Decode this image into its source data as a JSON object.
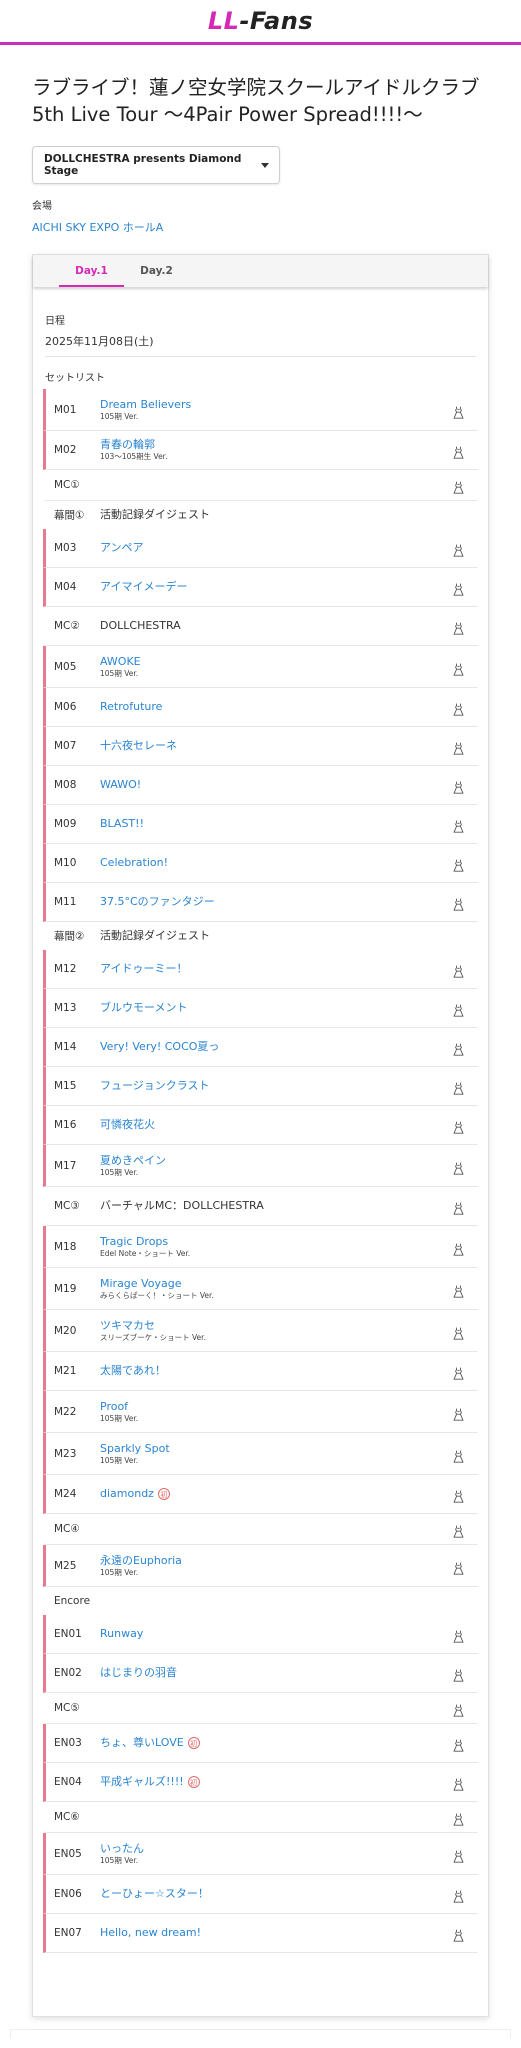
{
  "header": {
    "logo_a": "LL",
    "logo_b": "-Fans",
    "accent_color": "#d62ab6"
  },
  "page": {
    "title_line1": "ラブライブ！蓮ノ空女学院スクールアイドルクラブ",
    "title_line2": "5th Live Tour 〜4Pair Power Spread!!!!〜",
    "stage_select_value": "DOLLCHESTRA presents Diamond Stage",
    "venue_label": "会場",
    "venue_value": "AICHI SKY EXPO ホールA"
  },
  "tabs": [
    {
      "label": "Day.1",
      "active": true
    },
    {
      "label": "Day.2",
      "active": false
    }
  ],
  "day": {
    "date_label": "日程",
    "date_value": "2025年11月08日(土)",
    "setlist_label": "セットリスト"
  },
  "setlist": [
    {
      "num": "M01",
      "title": "Dream Believers",
      "ver": "105期 Ver.",
      "song": true
    },
    {
      "num": "M02",
      "title": "青春の輪郭",
      "ver": "103〜105期生 Ver.",
      "song": true
    },
    {
      "num": "MC①",
      "title": "",
      "ver": "",
      "song": false
    },
    {
      "num": "幕間①",
      "title": "活動記録ダイジェスト",
      "ver": "",
      "song": false,
      "plain": true
    },
    {
      "num": "M03",
      "title": "アンペア",
      "ver": "",
      "song": true
    },
    {
      "num": "M04",
      "title": "アイマイメーデー",
      "ver": "",
      "song": true
    },
    {
      "num": "MC②",
      "title": "DOLLCHESTRA",
      "ver": "",
      "song": false
    },
    {
      "num": "M05",
      "title": "AWOKE",
      "ver": "105期 Ver.",
      "song": true
    },
    {
      "num": "M06",
      "title": "Retrofuture",
      "ver": "",
      "song": true
    },
    {
      "num": "M07",
      "title": "十六夜セレーネ",
      "ver": "",
      "song": true
    },
    {
      "num": "M08",
      "title": "WAWO!",
      "ver": "",
      "song": true
    },
    {
      "num": "M09",
      "title": "BLAST!!",
      "ver": "",
      "song": true
    },
    {
      "num": "M10",
      "title": "Celebration!",
      "ver": "",
      "song": true
    },
    {
      "num": "M11",
      "title": "37.5°Cのファンタジー",
      "ver": "",
      "song": true
    },
    {
      "num": "幕間②",
      "title": "活動記録ダイジェスト",
      "ver": "",
      "song": false,
      "plain": true
    },
    {
      "num": "M12",
      "title": "アイドゥーミー！",
      "ver": "",
      "song": true
    },
    {
      "num": "M13",
      "title": "ブルウモーメント",
      "ver": "",
      "song": true
    },
    {
      "num": "M14",
      "title": "Very! Very! COCO夏っ",
      "ver": "",
      "song": true
    },
    {
      "num": "M15",
      "title": "フュージョンクラスト",
      "ver": "",
      "song": true
    },
    {
      "num": "M16",
      "title": "可憐夜花火",
      "ver": "",
      "song": true
    },
    {
      "num": "M17",
      "title": "夏めきペイン",
      "ver": "105期 Ver.",
      "song": true
    },
    {
      "num": "MC③",
      "title": "バーチャルMC：DOLLCHESTRA",
      "ver": "",
      "song": false
    },
    {
      "num": "M18",
      "title": "Tragic Drops",
      "ver": "Edel Note・ショート Ver.",
      "song": true
    },
    {
      "num": "M19",
      "title": "Mirage Voyage",
      "ver": "みらくらぱーく！・ショート Ver.",
      "song": true
    },
    {
      "num": "M20",
      "title": "ツキマカセ",
      "ver": "スリーズブーケ・ショート Ver.",
      "song": true
    },
    {
      "num": "M21",
      "title": "太陽であれ！",
      "ver": "",
      "song": true
    },
    {
      "num": "M22",
      "title": "Proof",
      "ver": "105期 Ver.",
      "song": true
    },
    {
      "num": "M23",
      "title": "Sparkly Spot",
      "ver": "105期 Ver.",
      "song": true
    },
    {
      "num": "M24",
      "title": "diamondz",
      "ver": "",
      "song": true,
      "badge": "初"
    },
    {
      "num": "MC④",
      "title": "",
      "ver": "",
      "song": false
    },
    {
      "num": "M25",
      "title": "永遠のEuphoria",
      "ver": "105期 Ver.",
      "song": true
    },
    {
      "num": "Encore",
      "title": "",
      "ver": "",
      "song": false,
      "plain": true
    },
    {
      "num": "EN01",
      "title": "Runway",
      "ver": "",
      "song": true
    },
    {
      "num": "EN02",
      "title": "はじまりの羽音",
      "ver": "",
      "song": true
    },
    {
      "num": "MC⑤",
      "title": "",
      "ver": "",
      "song": false
    },
    {
      "num": "EN03",
      "title": "ちょ、尊いLOVE",
      "ver": "",
      "song": true,
      "badge": "初"
    },
    {
      "num": "EN04",
      "title": "平成ギャルズ!!!!",
      "ver": "",
      "song": true,
      "badge": "初"
    },
    {
      "num": "MC⑥",
      "title": "",
      "ver": "",
      "song": false
    },
    {
      "num": "EN05",
      "title": "いったん",
      "ver": "105期 Ver.",
      "song": true
    },
    {
      "num": "EN06",
      "title": "とーひょー☆スター！",
      "ver": "",
      "song": true
    },
    {
      "num": "EN07",
      "title": "Hello, new dream!",
      "ver": "",
      "song": true
    }
  ]
}
